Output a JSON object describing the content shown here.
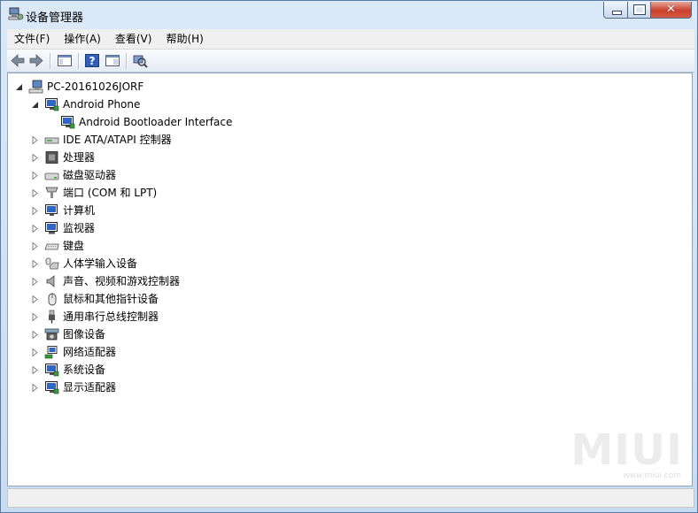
{
  "window": {
    "title": "设备管理器"
  },
  "menu": [
    {
      "label": "文件(F)"
    },
    {
      "label": "操作(A)"
    },
    {
      "label": "查看(V)"
    },
    {
      "label": "帮助(H)"
    }
  ],
  "tree": {
    "root": {
      "label": "PC-20161026JORF",
      "icon": "computer-icon"
    },
    "android_phone": {
      "label": "Android Phone",
      "icon": "monitor-icon"
    },
    "android_bootloader": {
      "label": "Android Bootloader Interface",
      "icon": "monitor-icon"
    },
    "categories": [
      {
        "label": "IDE ATA/ATAPI 控制器",
        "icon": "drive-controller-icon"
      },
      {
        "label": "处理器",
        "icon": "processor-icon"
      },
      {
        "label": "磁盘驱动器",
        "icon": "disk-drive-icon"
      },
      {
        "label": "端口 (COM 和 LPT)",
        "icon": "port-icon"
      },
      {
        "label": "计算机",
        "icon": "computer-icon"
      },
      {
        "label": "监视器",
        "icon": "monitor-icon"
      },
      {
        "label": "键盘",
        "icon": "keyboard-icon"
      },
      {
        "label": "人体学输入设备",
        "icon": "hid-icon"
      },
      {
        "label": "声音、视频和游戏控制器",
        "icon": "speaker-icon"
      },
      {
        "label": "鼠标和其他指针设备",
        "icon": "mouse-icon"
      },
      {
        "label": "通用串行总线控制器",
        "icon": "usb-icon"
      },
      {
        "label": "图像设备",
        "icon": "camera-icon"
      },
      {
        "label": "网络适配器",
        "icon": "network-icon"
      },
      {
        "label": "系统设备",
        "icon": "system-device-icon"
      },
      {
        "label": "显示适配器",
        "icon": "display-adapter-icon"
      }
    ]
  },
  "watermark": {
    "brand": "MIUI",
    "site": "www.miui.com"
  }
}
